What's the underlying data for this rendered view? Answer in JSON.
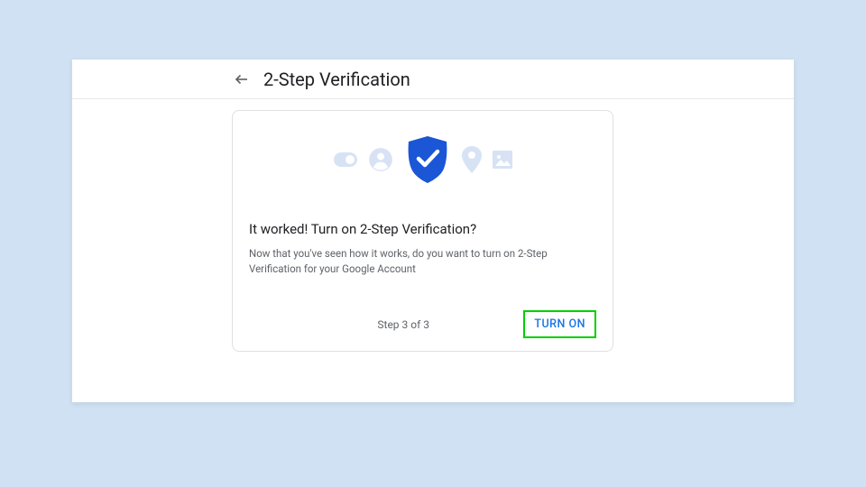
{
  "header": {
    "title": "2-Step Verification"
  },
  "card": {
    "heading": "It worked! Turn on 2-Step Verification?",
    "body": "Now that you've seen how it works, do you want to turn on 2-Step Verification for your Google Account",
    "step_indicator": "Step 3 of 3",
    "turn_on_label": "TURN ON"
  },
  "icons": {
    "toggle": "toggle-icon",
    "person": "person-icon",
    "shield": "shield-check-icon",
    "pin": "location-pin-icon",
    "image": "image-icon"
  },
  "colors": {
    "accent": "#1a73e8",
    "shield": "#1a56d6",
    "muted_icon": "#d7e3f4",
    "highlight_border": "#00d000"
  }
}
